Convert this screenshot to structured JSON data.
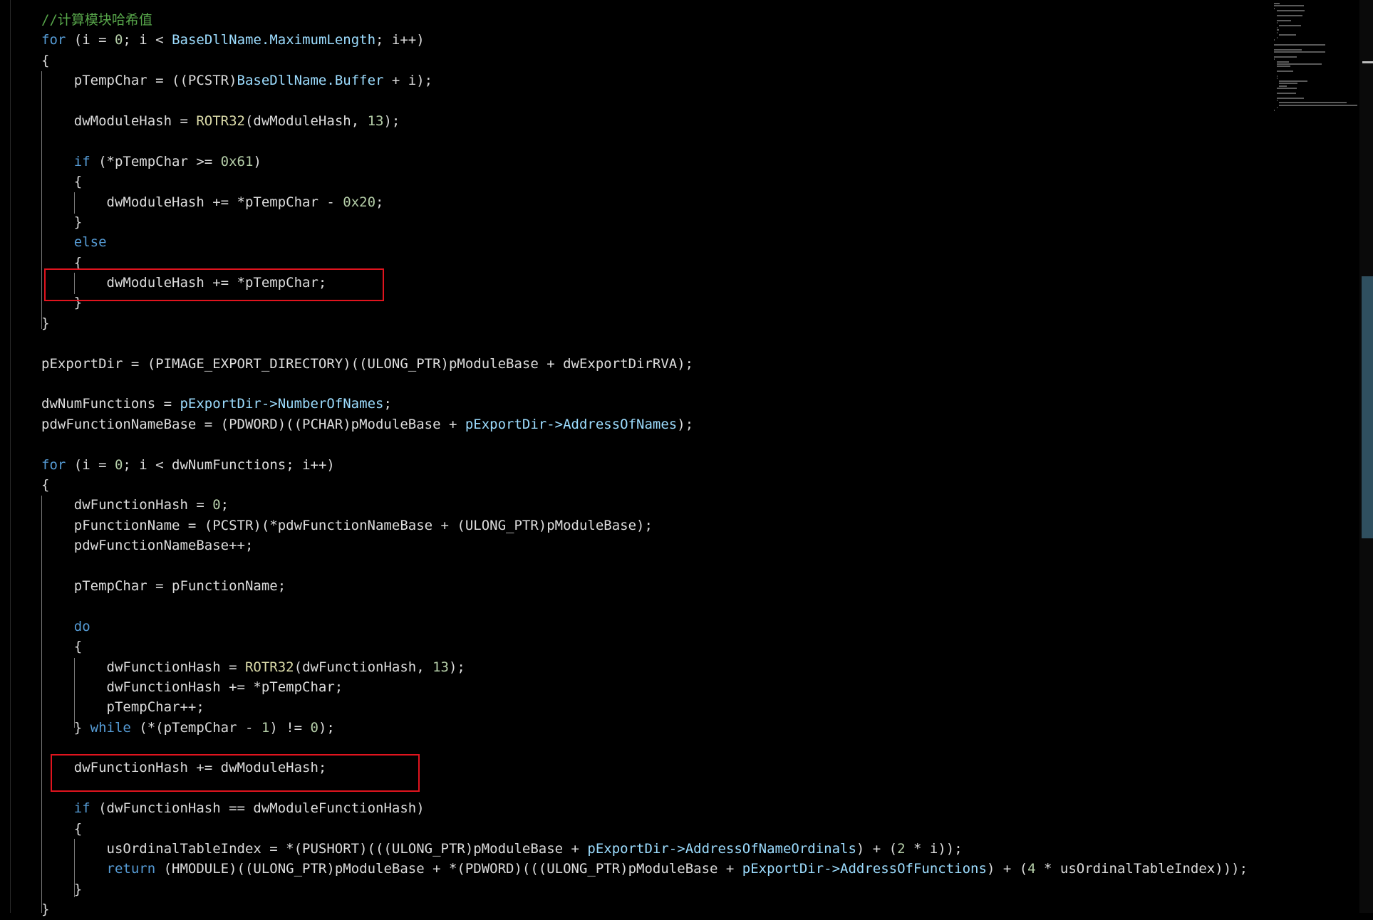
{
  "editor": {
    "highlight_color": "#e0141e",
    "theme": "dark",
    "lines": [
      [
        [
          "cm",
          "//计算模块哈希值"
        ]
      ],
      [
        [
          "kw",
          "for"
        ],
        [
          "id",
          " (i = "
        ],
        [
          "num",
          "0"
        ],
        [
          "id",
          "; i < "
        ],
        [
          "mem",
          "BaseDllName.MaximumLength"
        ],
        [
          "id",
          "; i++)"
        ]
      ],
      [
        [
          "id",
          "{"
        ]
      ],
      [
        [
          "id",
          "    pTempChar = ((PCSTR)"
        ],
        [
          "mem",
          "BaseDllName.Buffer"
        ],
        [
          "id",
          " + i);"
        ]
      ],
      [],
      [
        [
          "id",
          "    dwModuleHash = "
        ],
        [
          "fn",
          "ROTR32"
        ],
        [
          "id",
          "(dwModuleHash, "
        ],
        [
          "num",
          "13"
        ],
        [
          "id",
          ");"
        ]
      ],
      [],
      [
        [
          "kw",
          "    if"
        ],
        [
          "id",
          " (*pTempChar >= "
        ],
        [
          "num",
          "0x61"
        ],
        [
          "id",
          ")"
        ]
      ],
      [
        [
          "id",
          "    {"
        ]
      ],
      [
        [
          "id",
          "        dwModuleHash += *pTempChar - "
        ],
        [
          "num",
          "0x20"
        ],
        [
          "id",
          ";"
        ]
      ],
      [
        [
          "id",
          "    }"
        ]
      ],
      [
        [
          "kw",
          "    else"
        ]
      ],
      [
        [
          "id",
          "    {"
        ]
      ],
      [
        [
          "id",
          "        dwModuleHash += *pTempChar;"
        ]
      ],
      [
        [
          "id",
          "    }"
        ]
      ],
      [
        [
          "id",
          "}"
        ]
      ],
      [],
      [
        [
          "id",
          "pExportDir = (PIMAGE_EXPORT_DIRECTORY)((ULONG_PTR)pModuleBase + dwExportDirRVA);"
        ]
      ],
      [],
      [
        [
          "id",
          "dwNumFunctions = "
        ],
        [
          "mem",
          "pExportDir->NumberOfNames"
        ],
        [
          "id",
          ";"
        ]
      ],
      [
        [
          "id",
          "pdwFunctionNameBase = (PDWORD)((PCHAR)pModuleBase + "
        ],
        [
          "mem",
          "pExportDir->AddressOfNames"
        ],
        [
          "id",
          ");"
        ]
      ],
      [],
      [
        [
          "kw",
          "for"
        ],
        [
          "id",
          " (i = "
        ],
        [
          "num",
          "0"
        ],
        [
          "id",
          "; i < dwNumFunctions; i++)"
        ]
      ],
      [
        [
          "id",
          "{"
        ]
      ],
      [
        [
          "id",
          "    dwFunctionHash = "
        ],
        [
          "num",
          "0"
        ],
        [
          "id",
          ";"
        ]
      ],
      [
        [
          "id",
          "    pFunctionName = (PCSTR)(*pdwFunctionNameBase + (ULONG_PTR)pModuleBase);"
        ]
      ],
      [
        [
          "id",
          "    pdwFunctionNameBase++;"
        ]
      ],
      [],
      [
        [
          "id",
          "    pTempChar = pFunctionName;"
        ]
      ],
      [],
      [
        [
          "kw",
          "    do"
        ]
      ],
      [
        [
          "id",
          "    {"
        ]
      ],
      [
        [
          "id",
          "        dwFunctionHash = "
        ],
        [
          "fn",
          "ROTR32"
        ],
        [
          "id",
          "(dwFunctionHash, "
        ],
        [
          "num",
          "13"
        ],
        [
          "id",
          ");"
        ]
      ],
      [
        [
          "id",
          "        dwFunctionHash += *pTempChar;"
        ]
      ],
      [
        [
          "id",
          "        pTempChar++;"
        ]
      ],
      [
        [
          "id",
          "    } "
        ],
        [
          "kw",
          "while"
        ],
        [
          "id",
          " (*(pTempChar - "
        ],
        [
          "num",
          "1"
        ],
        [
          "id",
          ") != "
        ],
        [
          "num",
          "0"
        ],
        [
          "id",
          ");"
        ]
      ],
      [],
      [
        [
          "id",
          "    dwFunctionHash += dwModuleHash;"
        ]
      ],
      [],
      [
        [
          "kw",
          "    if"
        ],
        [
          "id",
          " (dwFunctionHash == dwModuleFunctionHash)"
        ]
      ],
      [
        [
          "id",
          "    {"
        ]
      ],
      [
        [
          "id",
          "        usOrdinalTableIndex = *(PUSHORT)(((ULONG_PTR)pModuleBase + "
        ],
        [
          "mem",
          "pExportDir->AddressOfNameOrdinals"
        ],
        [
          "id",
          ") + ("
        ],
        [
          "num",
          "2"
        ],
        [
          "id",
          " * i));"
        ]
      ],
      [
        [
          "kw",
          "        return"
        ],
        [
          "id",
          " (HMODULE)((ULONG_PTR)pModuleBase + *(PDWORD)(((ULONG_PTR)pModuleBase + "
        ],
        [
          "mem",
          "pExportDir->AddressOfFunctions"
        ],
        [
          "id",
          ") + ("
        ],
        [
          "num",
          "4"
        ],
        [
          "id",
          " * usOrdinalTableIndex)));"
        ]
      ],
      [
        [
          "id",
          "    }"
        ]
      ],
      [
        [
          "id",
          "}"
        ]
      ]
    ]
  }
}
